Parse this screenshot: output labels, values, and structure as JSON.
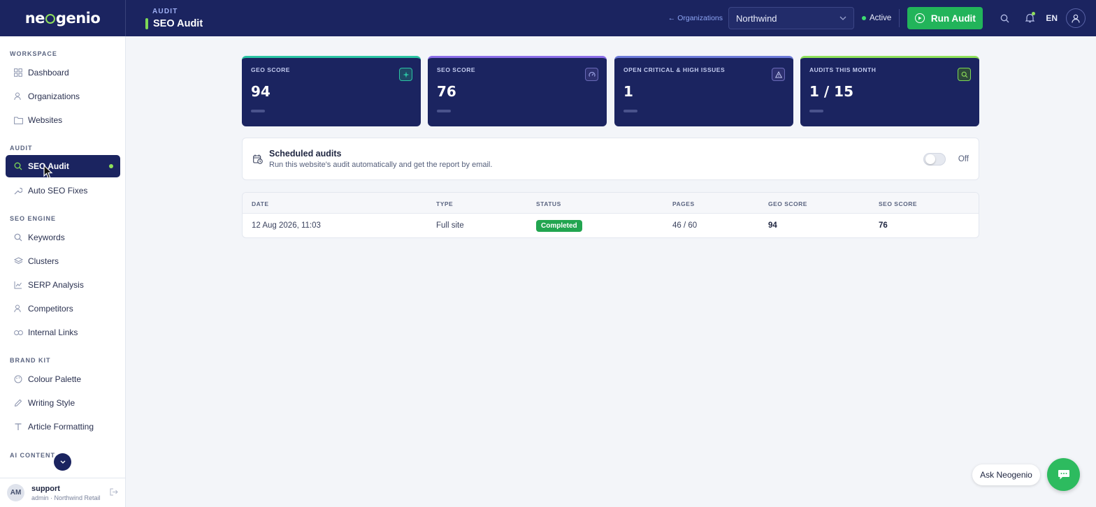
{
  "brand": {
    "logo_text_left": "ne",
    "logo_text_right": "genio",
    "accent": "#7ed957",
    "navy": "#1b2460"
  },
  "header": {
    "section": "AUDIT",
    "title": "SEO Audit",
    "back_link": "← Organizations",
    "org_selected": "Northwind",
    "status": "Active",
    "run_button": "Run Audit",
    "language": "EN",
    "icons": [
      "search-icon",
      "bell-icon",
      "user-icon"
    ]
  },
  "sidebar": {
    "sections": [
      {
        "title": "WORKSPACE",
        "items": [
          {
            "label": "Dashboard",
            "icon": "grid-icon"
          },
          {
            "label": "Organizations",
            "icon": "users-icon"
          },
          {
            "label": "Websites",
            "icon": "folder-icon"
          }
        ]
      },
      {
        "title": "AUDIT",
        "items": [
          {
            "label": "SEO Audit",
            "icon": "search-icon",
            "active": true
          },
          {
            "label": "Auto SEO Fixes",
            "icon": "wrench-icon"
          }
        ]
      },
      {
        "title": "SEO ENGINE",
        "items": [
          {
            "label": "Keywords",
            "icon": "search-icon"
          },
          {
            "label": "Clusters",
            "icon": "layers-icon"
          },
          {
            "label": "SERP Analysis",
            "icon": "chart-icon"
          },
          {
            "label": "Competitors",
            "icon": "users-icon"
          },
          {
            "label": "Internal Links",
            "icon": "link-icon"
          }
        ]
      },
      {
        "title": "BRAND KIT",
        "items": [
          {
            "label": "Colour Palette",
            "icon": "palette-icon"
          },
          {
            "label": "Writing Style",
            "icon": "pen-icon"
          },
          {
            "label": "Article Formatting",
            "icon": "type-icon"
          }
        ]
      },
      {
        "title": "AI CONTENT",
        "items": []
      }
    ],
    "user": {
      "initials": "AM",
      "name": "support",
      "role": "admin · Northwind Retail"
    }
  },
  "stats": [
    {
      "label": "GEO SCORE",
      "value": "94",
      "accent": "#2bc4a4",
      "icon": "sparkle-icon"
    },
    {
      "label": "SEO SCORE",
      "value": "76",
      "accent": "#8b6ee8",
      "icon": "gauge-icon"
    },
    {
      "label": "OPEN CRITICAL & HIGH ISSUES",
      "value": "1",
      "accent": "#6c7ad8",
      "icon": "warning-icon"
    },
    {
      "label": "AUDITS THIS MONTH",
      "value": "1 / 15",
      "accent": "#8fe05a",
      "icon": "search-icon"
    }
  ],
  "scheduled": {
    "title": "Scheduled audits",
    "subtitle": "Run this website's audit automatically and get the report by email.",
    "toggle_label": "Off"
  },
  "table": {
    "columns": [
      "DATE",
      "TYPE",
      "STATUS",
      "PAGES",
      "GEO SCORE",
      "SEO SCORE"
    ],
    "rows": [
      {
        "date": "12 Aug 2026, 11:03",
        "type": "Full site",
        "status": "Completed",
        "pages": "46 / 60",
        "geo": "94",
        "seo": "76"
      }
    ]
  },
  "assistant": {
    "label": "Ask Neogenio"
  }
}
